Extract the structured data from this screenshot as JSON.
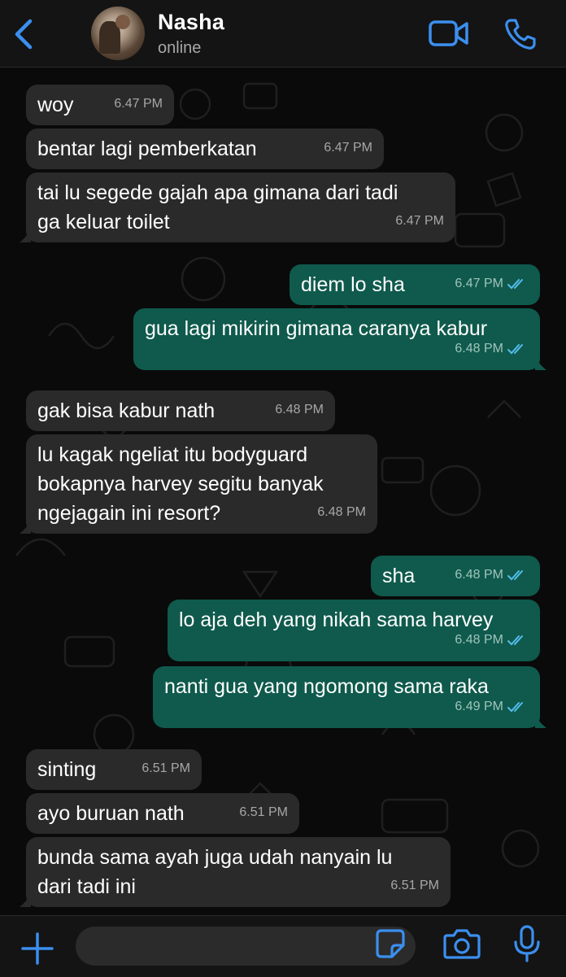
{
  "theme": {
    "accent": "#3b8fef",
    "incoming_bubble": "#2a2a2a",
    "outgoing_bubble": "#0f5a4c",
    "read_tick": "#53bdeb"
  },
  "header": {
    "name": "Nasha",
    "status": "online",
    "icons": {
      "back": "chevron-left-icon",
      "video": "video-camera-icon",
      "call": "phone-icon"
    }
  },
  "messages": [
    {
      "dir": "in",
      "text": "woy",
      "time": "6.47 PM"
    },
    {
      "dir": "in",
      "text": "bentar lagi pemberkatan",
      "time": "6.47 PM"
    },
    {
      "dir": "in",
      "text": "tai lu segede gajah apa gimana dari tadi\nga keluar toilet",
      "time": "6.47 PM"
    },
    {
      "dir": "out",
      "text": "diem lo sha",
      "time": "6.47 PM",
      "read": true
    },
    {
      "dir": "out",
      "text": "gua lagi mikirin gimana caranya kabur",
      "time": "6.48 PM",
      "read": true
    },
    {
      "dir": "in",
      "text": "gak bisa kabur nath",
      "time": "6.48 PM"
    },
    {
      "dir": "in",
      "text": "lu kagak ngeliat itu bodyguard\nbokapnya harvey segitu banyak\nngejagain ini resort?",
      "time": "6.48 PM"
    },
    {
      "dir": "out",
      "text": "sha",
      "time": "6.48 PM",
      "read": true
    },
    {
      "dir": "out",
      "text": "lo aja deh yang nikah sama harvey",
      "time": "6.48 PM",
      "read": true
    },
    {
      "dir": "out",
      "text": "nanti gua yang ngomong sama raka",
      "time": "6.49 PM",
      "read": true
    },
    {
      "dir": "in",
      "text": "sinting",
      "time": "6.51 PM"
    },
    {
      "dir": "in",
      "text": "ayo buruan nath",
      "time": "6.51 PM"
    },
    {
      "dir": "in",
      "text": "bunda sama ayah juga udah nanyain lu\ndari tadi ini",
      "time": "6.51 PM"
    }
  ],
  "composer": {
    "value": "",
    "icons": {
      "attach": "plus-icon",
      "sticker": "sticker-icon",
      "camera": "camera-icon",
      "mic": "microphone-icon"
    }
  }
}
